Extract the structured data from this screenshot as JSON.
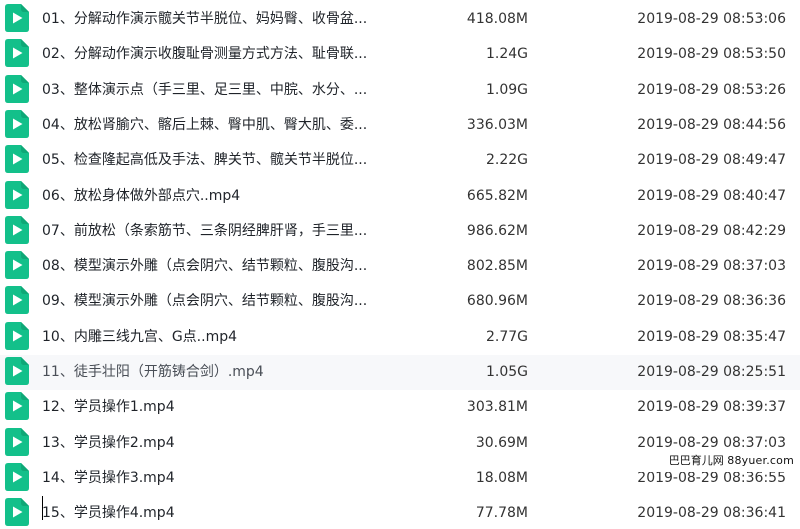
{
  "colors": {
    "icon": "#13c08a",
    "row_highlight": "#f7f8fa"
  },
  "file_icon": "play-video-icon",
  "files": [
    {
      "name": "01、分解动作演示髋关节半脱位、妈妈臀、收骨盆...",
      "size": "418.08M",
      "date": "2019-08-29 08:53:06"
    },
    {
      "name": "02、分解动作演示收腹耻骨测量方式方法、耻骨联...",
      "size": "1.24G",
      "date": "2019-08-29 08:53:50"
    },
    {
      "name": "03、整体演示点（手三里、足三里、中脘、水分、...",
      "size": "1.09G",
      "date": "2019-08-29 08:53:26"
    },
    {
      "name": "04、放松肾腧穴、髂后上棘、臀中肌、臀大肌、委...",
      "size": "336.03M",
      "date": "2019-08-29 08:44:56"
    },
    {
      "name": "05、检查隆起高低及手法、脾关节、髋关节半脱位...",
      "size": "2.22G",
      "date": "2019-08-29 08:49:47"
    },
    {
      "name": "06、放松身体做外部点穴..mp4",
      "size": "665.82M",
      "date": "2019-08-29 08:40:47"
    },
    {
      "name": "07、前放松（条索筋节、三条阴经脾肝肾，手三里...",
      "size": "986.62M",
      "date": "2019-08-29 08:42:29"
    },
    {
      "name": "08、模型演示外雕（点会阴穴、结节颗粒、腹股沟...",
      "size": "802.85M",
      "date": "2019-08-29 08:37:03"
    },
    {
      "name": "09、模型演示外雕（点会阴穴、结节颗粒、腹股沟...",
      "size": "680.96M",
      "date": "2019-08-29 08:36:36"
    },
    {
      "name": "10、内雕三线九宫、G点..mp4",
      "size": "2.77G",
      "date": "2019-08-29 08:35:47"
    },
    {
      "name": "11、徒手壮阳（开筋铸合剑）.mp4",
      "size": "1.05G",
      "date": "2019-08-29 08:25:51"
    },
    {
      "name": "12、学员操作1.mp4",
      "size": "303.81M",
      "date": "2019-08-29 08:39:37"
    },
    {
      "name": "13、学员操作2.mp4",
      "size": "30.69M",
      "date": "2019-08-29 08:37:03"
    },
    {
      "name": "14、学员操作3.mp4",
      "size": "18.08M",
      "date": "2019-08-29 08:36:55"
    },
    {
      "name": "15、学员操作4.mp4",
      "size": "77.78M",
      "date": "2019-08-29 08:36:41"
    }
  ],
  "watermark": {
    "site": "巴巴育儿网",
    "domain": "88yuer.com"
  }
}
